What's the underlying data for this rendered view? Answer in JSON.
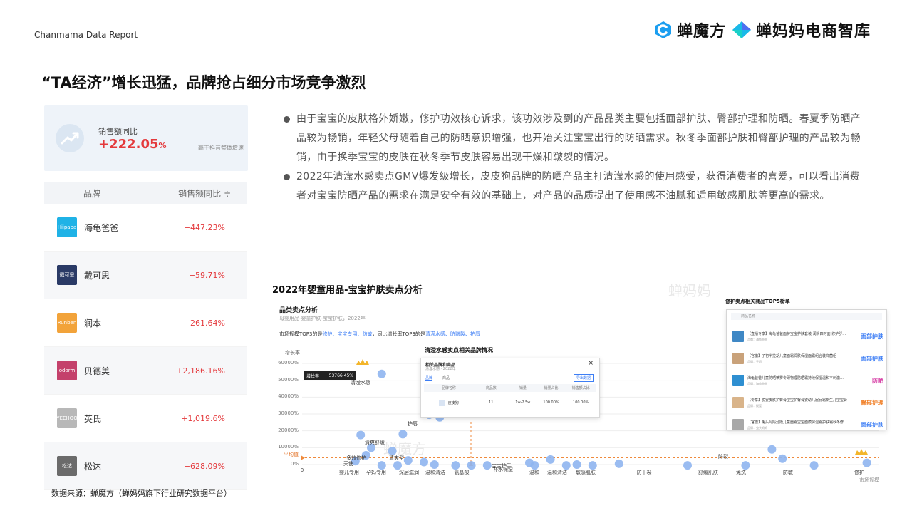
{
  "header": {
    "report_label": "Chanmama Data Report",
    "logo1": "蝉魔方",
    "logo2": "蝉妈妈电商智库"
  },
  "page_title": "“TA经济”增长迅猛，品牌抢占细分市场竞争激烈",
  "summary": {
    "caption": "销售额同比",
    "value": "+222.05",
    "unit": "%",
    "note": "高于抖音整体增速"
  },
  "brand_table": {
    "col_brand": "品牌",
    "col_growth": "销售额同比 ≑",
    "rows": [
      {
        "logo_text": "Hiipapa",
        "name": "海龟爸爸",
        "growth": "+447.23%",
        "logo_color": "#1fb2e6"
      },
      {
        "logo_text": "戴可思",
        "name": "戴可思",
        "growth": "+59.71%",
        "logo_color": "#2a3a66"
      },
      {
        "logo_text": "Runben",
        "name": "润本",
        "growth": "+261.64%",
        "logo_color": "#f2a33a"
      },
      {
        "logo_text": "odorm",
        "name": "贝德美",
        "growth": "+2,186.16%",
        "logo_color": "#c4416b"
      },
      {
        "logo_text": "YEEHOO",
        "name": "英氏",
        "growth": "+1,019.6%",
        "logo_color": "#b8b8b8"
      },
      {
        "logo_text": "松达",
        "name": "松达",
        "growth": "+628.09%",
        "logo_color": "#6b6b6b"
      }
    ]
  },
  "source_note": "数据来源：蝉魔方（蝉妈妈旗下行业研究数据平台）",
  "bullets": [
    "由于宝宝的皮肤格外娇嫩，修护功效核心诉求，该功效涉及到的产品品类主要包括面部护肤、臀部护理和防晒。春夏季防晒产品较为畅销，年轻父母随着自己的防晒意识增强，也开始关注宝宝出行的防晒需求。秋冬季面部护肤和臀部护理的产品较为畅销，由于换季宝宝的皮肤在秋冬季节皮肤容易出现干燥和皲裂的情况。",
    "2022年清滢水感卖点GMV爆发级增长，皮皮狗品牌的防晒产品主打清滢水感的使用感受，获得消费者的喜爱，可以看出消费者对宝宝防晒产品的需求在满足安全有效的基础上，对产品的品质提出了使用感不油腻和适用敏感肌肤等更高的需求。"
  ],
  "chart_panel": {
    "title": "2022年婴童用品-宝宝护肤卖点分析",
    "section": "品类卖点分析",
    "subtitle": "母婴用品-婴童护肤-宝宝护肤，2022年",
    "line_prefix": "市场规模TOP3的是",
    "line_top3": "修护、宝宝专用、防敏",
    "line_mid": "，同比增长率TOP3的是",
    "line_growth3": "清滢水感、防皲裂、护唇",
    "y_axis_title": "增长率",
    "avg_label": "平均值",
    "x_corner_label": "市场规模",
    "tooltip_label": "增长率",
    "tooltip_value": "53766.45%",
    "modal": {
      "header": "清滢水感卖点相关品牌情况",
      "title": "相关品牌和商品",
      "subtitle": "清滢水感 · 2022年",
      "close": "×",
      "tab1": "品牌",
      "tab2": "商品",
      "export": "导出数据",
      "cols": [
        "品牌名称",
        "商品数",
        "销量",
        "销量占比",
        "销售额占比"
      ],
      "row": [
        "皮皮狗",
        "11",
        "1w-2.5w",
        "100.00%",
        "100.00%"
      ]
    },
    "top5": {
      "title": "修护卖点相关商品TOP5榜单",
      "col": "商品名称",
      "items": [
        {
          "name": "【直播专享】海龟爸爸面护宝宝护肤套装 润滑四时面 修护舒缓 A",
          "meta": "品牌：海龟爸爸",
          "tag": "面部护肤",
          "tag_color": "blue",
          "thumb": "#3f88c5"
        },
        {
          "name": "【官旗】子初半拉胡儿童面霜润肤保湿面霜组合装抑菌组",
          "meta": "品牌：子初",
          "tag": "面部护肤",
          "tag_color": "blue",
          "thumb": "#c9a27a"
        },
        {
          "name": "海龟爸爸儿童防晒喷雾专研物理防晒霜持续保湿温和不刺激的晒霜",
          "meta": "品牌：海龟爸爸",
          "tag": "防晒",
          "tag_color": "magenta",
          "thumb": "#2e8fd1"
        },
        {
          "name": "【专享】悦婴皮肤护臀膏宝宝护臀膏婴幼儿屁屁霜新生儿宝宝膏",
          "meta": "品牌：悦婴",
          "tag": "臀部护理",
          "tag_color": "orange",
          "thumb": "#d9b48a"
        },
        {
          "name": "【官旗】兔头妈妈分娩儿童面霜宝宝面膜保湿霜护肤霜秋冬修",
          "meta": "品牌：兔头妈妈",
          "tag": "面部护肤",
          "tag_color": "blue",
          "thumb": "#a8a8a8"
        }
      ]
    }
  },
  "chart_data": {
    "type": "scatter",
    "title": "品类卖点分析",
    "xlabel": "市场规模",
    "ylabel": "增长率",
    "y_ticks": [
      "60000%",
      "50000%",
      "40000%",
      "30000%",
      "20000%",
      "10000%",
      "0%"
    ],
    "y_range": [
      0,
      60000
    ],
    "x_origin_label": "0",
    "average_line": 4000,
    "category_labels": [
      "婴儿专用",
      "孕妈专用",
      "深层滋润",
      "温和清洁",
      "氨基酸",
      "补水保湿",
      "温和",
      "温和清洁",
      "敏感肌肤",
      "防干裂",
      "舒缓肌肤",
      "免洗",
      "防敏",
      "修护"
    ],
    "point_labels": [
      "清滢水感",
      "护唇",
      "清爽舒缓",
      "天使",
      "多效修护",
      "清爽型",
      "宝宝护手",
      "防裂"
    ],
    "points": [
      {
        "x": 0.07,
        "y": 53766
      },
      {
        "x": 0.16,
        "y": 29500
      },
      {
        "x": 0.18,
        "y": 28000
      },
      {
        "x": 0.03,
        "y": 17500
      },
      {
        "x": 0.11,
        "y": 18000
      },
      {
        "x": 0.09,
        "y": 8000
      },
      {
        "x": 0.05,
        "y": 10000
      },
      {
        "x": 0.02,
        "y": 2000
      },
      {
        "x": 0.04,
        "y": 5500
      },
      {
        "x": 0.07,
        "y": -500
      },
      {
        "x": 0.1,
        "y": -500
      },
      {
        "x": 0.12,
        "y": 2500
      },
      {
        "x": 0.15,
        "y": 1500
      },
      {
        "x": 0.17,
        "y": 0
      },
      {
        "x": 0.21,
        "y": -500
      },
      {
        "x": 0.24,
        "y": -500
      },
      {
        "x": 0.27,
        "y": -500
      },
      {
        "x": 0.35,
        "y": 1000
      },
      {
        "x": 0.36,
        "y": -500
      },
      {
        "x": 0.39,
        "y": 3000
      },
      {
        "x": 0.42,
        "y": -500
      },
      {
        "x": 0.44,
        "y": 0
      },
      {
        "x": 0.47,
        "y": -500
      },
      {
        "x": 0.52,
        "y": 500
      },
      {
        "x": 0.65,
        "y": -500
      },
      {
        "x": 0.76,
        "y": -500
      },
      {
        "x": 0.81,
        "y": 9000
      },
      {
        "x": 0.83,
        "y": 3500
      },
      {
        "x": 0.89,
        "y": -500
      },
      {
        "x": 0.99,
        "y": 1000
      }
    ]
  },
  "watermarks": [
    "蝉魔方",
    "蝉妈妈"
  ]
}
